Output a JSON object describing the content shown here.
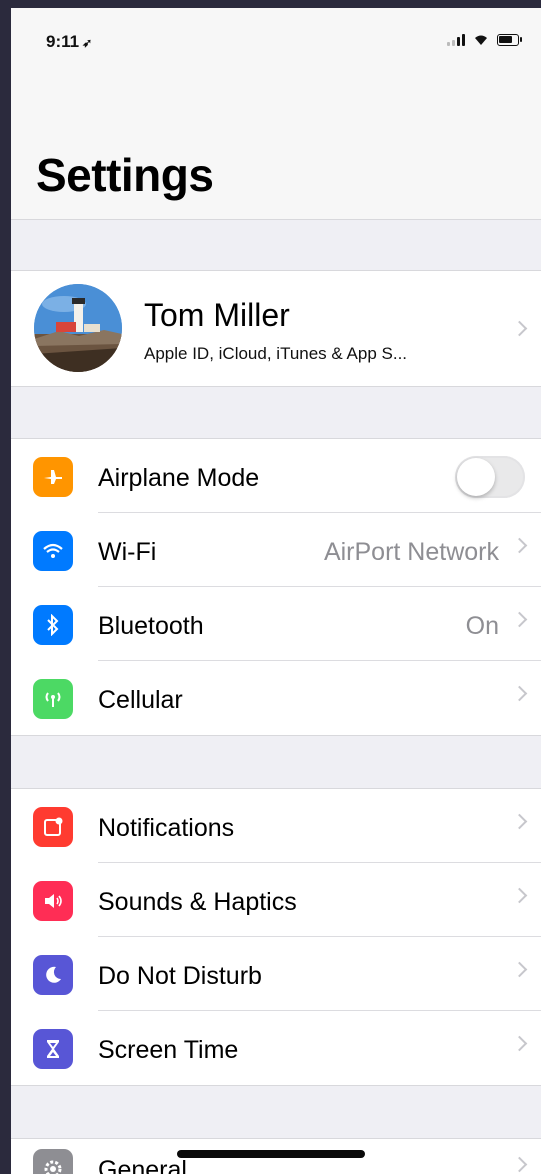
{
  "status_bar": {
    "time": "9:11",
    "location_glyph": "➶"
  },
  "header": {
    "title": "Settings"
  },
  "profile": {
    "name": "Tom Miller",
    "subtitle": "Apple ID, iCloud, iTunes & App S..."
  },
  "group1": [
    {
      "label": "Airplane Mode",
      "icon": "airplane-icon",
      "color": "#ff9500",
      "control": "toggle",
      "on": false
    },
    {
      "label": "Wi-Fi",
      "icon": "wifi-icon",
      "color": "#007aff",
      "value": "AirPort Network"
    },
    {
      "label": "Bluetooth",
      "icon": "bluetooth-icon",
      "color": "#007aff",
      "value": "On"
    },
    {
      "label": "Cellular",
      "icon": "cellular-icon",
      "color": "#4cd964",
      "value": ""
    }
  ],
  "group2": [
    {
      "label": "Notifications",
      "icon": "notifications-icon",
      "color": "#ff3b30"
    },
    {
      "label": "Sounds & Haptics",
      "icon": "sounds-icon",
      "color": "#ff2d55"
    },
    {
      "label": "Do Not Disturb",
      "icon": "moon-icon",
      "color": "#5856d6"
    },
    {
      "label": "Screen Time",
      "icon": "hourglass-icon",
      "color": "#5856d6"
    }
  ],
  "group3": [
    {
      "label": "General",
      "icon": "gear-icon",
      "color": "#8e8e93"
    }
  ]
}
